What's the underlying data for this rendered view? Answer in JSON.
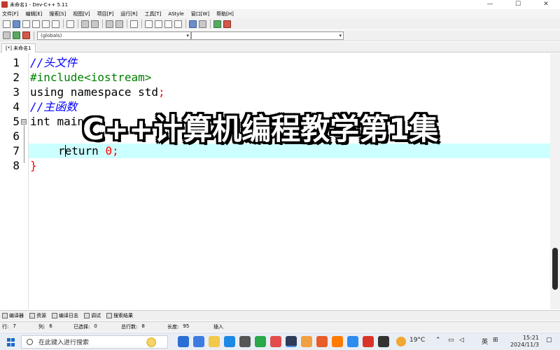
{
  "window": {
    "title": "未命名1 - Dev-C++ 5.11",
    "controls": {
      "minimize": "—",
      "maximize": "☐",
      "close": "✕"
    }
  },
  "menu": {
    "items": [
      "文件[F]",
      "编辑[E]",
      "搜索[S]",
      "视图[V]",
      "项目[P]",
      "运行[R]",
      "工具[T]",
      "AStyle",
      "窗口[W]",
      "帮助[H]"
    ]
  },
  "toolbar": {
    "scope_combo": "(globals)",
    "second_combo": ""
  },
  "tab": {
    "label": "[*] 未命名1"
  },
  "editor": {
    "line_numbers": [
      "1",
      "2",
      "3",
      "4",
      "5",
      "6",
      "7",
      "8"
    ],
    "fold_markers": [
      "⊟"
    ],
    "lines": {
      "l1": "//头文件",
      "l2": "#include<iostream>",
      "l3_a": "using namespace std",
      "l3_b": ";",
      "l4": "//主函数",
      "l5_a": "int main",
      "l5_b": "(",
      "l6": "",
      "l7_a": "return ",
      "l7_b": "0",
      "l7_c": ";",
      "l8": "}"
    }
  },
  "overlay": {
    "text": "C++计算机编程教学第1集"
  },
  "bottom_tabs": [
    "编译器",
    "资源",
    "编译日志",
    "调试",
    "搜索结果"
  ],
  "status": {
    "row_label": "行:",
    "row": "7",
    "col_label": "列:",
    "col": "6",
    "sel_label": "已选择:",
    "sel": "0",
    "total_label": "总行数:",
    "total": "8",
    "len_label": "长度:",
    "len": "95",
    "mode": "插入"
  },
  "taskbar": {
    "search_placeholder": "在此键入进行搜索",
    "weather": "19°C",
    "ime": "英",
    "time": "15:21",
    "date": "2024/11/3"
  },
  "colors": {
    "comment": "#0000ff",
    "preprocessor": "#008000",
    "number": "#ff0000",
    "current_line": "#ccffff"
  }
}
